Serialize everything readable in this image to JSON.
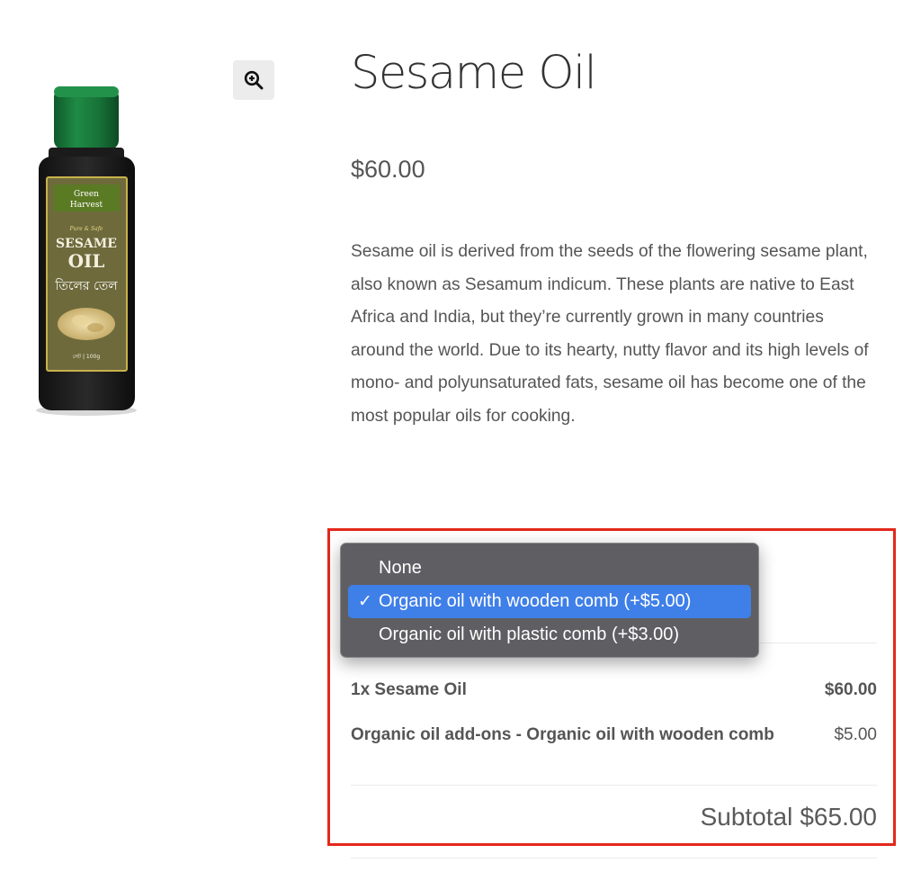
{
  "product": {
    "title": "Sesame Oil",
    "price": "$60.00",
    "description": "Sesame oil is derived from the seeds of the flowering sesame plant, also known as Sesamum indicum. These plants are native to East Africa and India, but they’re currently grown in many countries around the world. Due to its hearty, nutty flavor and its high levels of mono- and polyunsaturated fats, sesame oil has become one of the most popular oils for cooking.",
    "image": {
      "brand_line1": "Green",
      "brand_line2": "Harvest",
      "tagline": "Pure & Safe",
      "name_line1": "SESAME",
      "name_line2": "OIL",
      "name_bengali": "তিলের তেল",
      "weight": "নেট | 100g"
    }
  },
  "zoom": {
    "icon": "zoom-in-icon"
  },
  "addons": {
    "dropdown": {
      "options": [
        {
          "label": "None",
          "selected": false
        },
        {
          "label": "Organic oil with wooden comb (+$5.00)",
          "selected": true
        },
        {
          "label": "Organic oil with plastic comb (+$3.00)",
          "selected": false
        }
      ],
      "check_mark": "✓"
    },
    "summary": {
      "line_item_label": "1x Sesame Oil",
      "line_item_value": "$60.00",
      "addon_label": "Organic oil add-ons - Organic oil with wooden comb",
      "addon_value": "$5.00",
      "subtotal_label": "Subtotal",
      "subtotal_value": "$65.00"
    }
  },
  "colors": {
    "highlight_border": "#e3281b",
    "dropdown_bg": "#5f5f63",
    "dropdown_selected": "#3f7fe8",
    "bottle_cap": "#1a7a3c",
    "label_bg": "#6e6a3c"
  }
}
